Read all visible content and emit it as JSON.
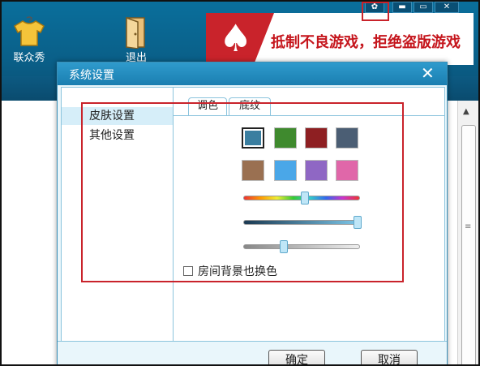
{
  "topbar": {
    "items": [
      {
        "label": "联众秀",
        "icon": "tshirt-icon"
      },
      {
        "label": "退出",
        "icon": "exit-door-icon"
      }
    ],
    "banner": {
      "slogan": "抵制不良游戏，拒绝盗版游戏"
    },
    "window_buttons": [
      "settings",
      "minimize",
      "restore",
      "close"
    ]
  },
  "dialog": {
    "title": "系统设置",
    "nav": [
      {
        "label": "皮肤设置",
        "selected": true
      },
      {
        "label": "其他设置",
        "selected": false
      }
    ],
    "tabs": [
      {
        "label": "调色",
        "active": true
      },
      {
        "label": "底纹",
        "active": false
      }
    ],
    "swatches": [
      {
        "color": "#3a7ea0",
        "selected": true
      },
      {
        "color": "#3f8a2e"
      },
      {
        "color": "#8e1f22"
      },
      {
        "color": "#4b5e74"
      },
      {
        "color": "#9a7051"
      },
      {
        "color": "#4aa7e8"
      },
      {
        "color": "#8f67c4"
      },
      {
        "color": "#e067a9"
      }
    ],
    "sliders": [
      {
        "name": "hue",
        "level": 0.53
      },
      {
        "name": "saturation",
        "level": 0.98
      },
      {
        "name": "brightness",
        "level": 0.35
      }
    ],
    "checkbox": {
      "label": "房间背景也换色",
      "checked": false
    },
    "buttons": {
      "ok": "确定",
      "cancel": "取消"
    }
  },
  "colors": {
    "accent": "#1a7eb0",
    "highlight": "#c9232b",
    "dialog_bg": "#e9f6fb"
  }
}
